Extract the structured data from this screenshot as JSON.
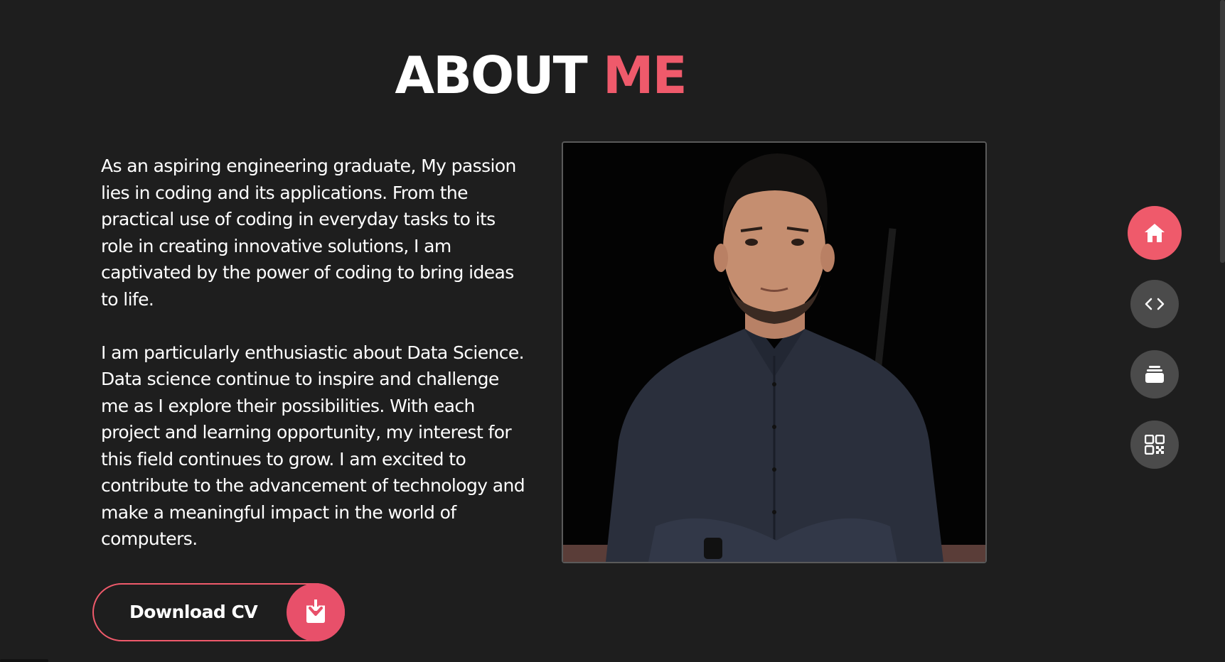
{
  "heading": {
    "word1": "ABOUT",
    "word2": "ME"
  },
  "about": {
    "paragraphs": [
      "As an aspiring engineering graduate, My passion lies in coding and its applications. From the practical use of coding in everyday tasks to its role in creating innovative solutions, I am captivated by the power of coding to bring ideas to life.",
      "I am particularly enthusiastic about Data Science. Data science continue to inspire and challenge me as I explore their possibilities. With each project and learning opportunity, my interest for this field continues to grow. I am excited to contribute to the advancement of technology and make a meaningful impact in the world of computers."
    ]
  },
  "download": {
    "label": "Download CV",
    "icon": "download-icon"
  },
  "nav": {
    "items": [
      {
        "icon": "home-icon",
        "active": true
      },
      {
        "icon": "code-icon",
        "active": false
      },
      {
        "icon": "stack-icon",
        "active": false
      },
      {
        "icon": "qr-code-icon",
        "active": false
      }
    ]
  },
  "colors": {
    "background": "#1e1e1e",
    "accent": "#ef5a6b",
    "nav_inactive": "#4b4b4b",
    "text": "#ffffff"
  }
}
